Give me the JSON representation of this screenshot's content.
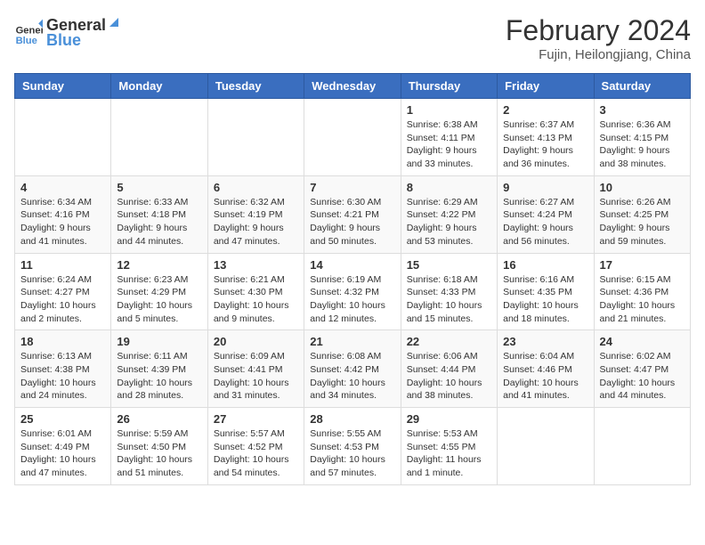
{
  "header": {
    "logo_general": "General",
    "logo_blue": "Blue",
    "month_year": "February 2024",
    "location": "Fujin, Heilongjiang, China"
  },
  "weekdays": [
    "Sunday",
    "Monday",
    "Tuesday",
    "Wednesday",
    "Thursday",
    "Friday",
    "Saturday"
  ],
  "weeks": [
    [
      {
        "day": "",
        "info": ""
      },
      {
        "day": "",
        "info": ""
      },
      {
        "day": "",
        "info": ""
      },
      {
        "day": "",
        "info": ""
      },
      {
        "day": "1",
        "info": "Sunrise: 6:38 AM\nSunset: 4:11 PM\nDaylight: 9 hours and 33 minutes."
      },
      {
        "day": "2",
        "info": "Sunrise: 6:37 AM\nSunset: 4:13 PM\nDaylight: 9 hours and 36 minutes."
      },
      {
        "day": "3",
        "info": "Sunrise: 6:36 AM\nSunset: 4:15 PM\nDaylight: 9 hours and 38 minutes."
      }
    ],
    [
      {
        "day": "4",
        "info": "Sunrise: 6:34 AM\nSunset: 4:16 PM\nDaylight: 9 hours and 41 minutes."
      },
      {
        "day": "5",
        "info": "Sunrise: 6:33 AM\nSunset: 4:18 PM\nDaylight: 9 hours and 44 minutes."
      },
      {
        "day": "6",
        "info": "Sunrise: 6:32 AM\nSunset: 4:19 PM\nDaylight: 9 hours and 47 minutes."
      },
      {
        "day": "7",
        "info": "Sunrise: 6:30 AM\nSunset: 4:21 PM\nDaylight: 9 hours and 50 minutes."
      },
      {
        "day": "8",
        "info": "Sunrise: 6:29 AM\nSunset: 4:22 PM\nDaylight: 9 hours and 53 minutes."
      },
      {
        "day": "9",
        "info": "Sunrise: 6:27 AM\nSunset: 4:24 PM\nDaylight: 9 hours and 56 minutes."
      },
      {
        "day": "10",
        "info": "Sunrise: 6:26 AM\nSunset: 4:25 PM\nDaylight: 9 hours and 59 minutes."
      }
    ],
    [
      {
        "day": "11",
        "info": "Sunrise: 6:24 AM\nSunset: 4:27 PM\nDaylight: 10 hours and 2 minutes."
      },
      {
        "day": "12",
        "info": "Sunrise: 6:23 AM\nSunset: 4:29 PM\nDaylight: 10 hours and 5 minutes."
      },
      {
        "day": "13",
        "info": "Sunrise: 6:21 AM\nSunset: 4:30 PM\nDaylight: 10 hours and 9 minutes."
      },
      {
        "day": "14",
        "info": "Sunrise: 6:19 AM\nSunset: 4:32 PM\nDaylight: 10 hours and 12 minutes."
      },
      {
        "day": "15",
        "info": "Sunrise: 6:18 AM\nSunset: 4:33 PM\nDaylight: 10 hours and 15 minutes."
      },
      {
        "day": "16",
        "info": "Sunrise: 6:16 AM\nSunset: 4:35 PM\nDaylight: 10 hours and 18 minutes."
      },
      {
        "day": "17",
        "info": "Sunrise: 6:15 AM\nSunset: 4:36 PM\nDaylight: 10 hours and 21 minutes."
      }
    ],
    [
      {
        "day": "18",
        "info": "Sunrise: 6:13 AM\nSunset: 4:38 PM\nDaylight: 10 hours and 24 minutes."
      },
      {
        "day": "19",
        "info": "Sunrise: 6:11 AM\nSunset: 4:39 PM\nDaylight: 10 hours and 28 minutes."
      },
      {
        "day": "20",
        "info": "Sunrise: 6:09 AM\nSunset: 4:41 PM\nDaylight: 10 hours and 31 minutes."
      },
      {
        "day": "21",
        "info": "Sunrise: 6:08 AM\nSunset: 4:42 PM\nDaylight: 10 hours and 34 minutes."
      },
      {
        "day": "22",
        "info": "Sunrise: 6:06 AM\nSunset: 4:44 PM\nDaylight: 10 hours and 38 minutes."
      },
      {
        "day": "23",
        "info": "Sunrise: 6:04 AM\nSunset: 4:46 PM\nDaylight: 10 hours and 41 minutes."
      },
      {
        "day": "24",
        "info": "Sunrise: 6:02 AM\nSunset: 4:47 PM\nDaylight: 10 hours and 44 minutes."
      }
    ],
    [
      {
        "day": "25",
        "info": "Sunrise: 6:01 AM\nSunset: 4:49 PM\nDaylight: 10 hours and 47 minutes."
      },
      {
        "day": "26",
        "info": "Sunrise: 5:59 AM\nSunset: 4:50 PM\nDaylight: 10 hours and 51 minutes."
      },
      {
        "day": "27",
        "info": "Sunrise: 5:57 AM\nSunset: 4:52 PM\nDaylight: 10 hours and 54 minutes."
      },
      {
        "day": "28",
        "info": "Sunrise: 5:55 AM\nSunset: 4:53 PM\nDaylight: 10 hours and 57 minutes."
      },
      {
        "day": "29",
        "info": "Sunrise: 5:53 AM\nSunset: 4:55 PM\nDaylight: 11 hours and 1 minute."
      },
      {
        "day": "",
        "info": ""
      },
      {
        "day": "",
        "info": ""
      }
    ]
  ]
}
